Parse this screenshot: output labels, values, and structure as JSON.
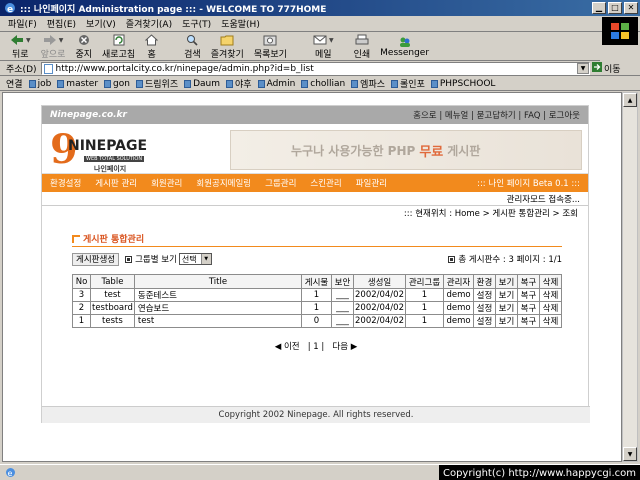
{
  "window": {
    "title": "::: 나인페이지 Administration page ::: - WELCOME TO 777HOME"
  },
  "menu": [
    "파일(F)",
    "편집(E)",
    "보기(V)",
    "즐겨찾기(A)",
    "도구(T)",
    "도움말(H)"
  ],
  "toolbar": {
    "back": "뒤로",
    "forward": "앞으로",
    "stop": "중지",
    "refresh": "새로고침",
    "home": "홈",
    "search": "검색",
    "favorites": "즐겨찾기",
    "history": "목록보기",
    "mail": "메일",
    "print": "인쇄",
    "messenger": "Messenger"
  },
  "address": {
    "label": "주소(D)",
    "url": "http://www.portalcity.co.kr/ninepage/admin.php?id=b_list",
    "go": "이동"
  },
  "links": {
    "label": "연결",
    "items": [
      "job",
      "master",
      "gon",
      "드림위즈",
      "Daum",
      "야후",
      "Admin",
      "chollian",
      "엠파스",
      "롤인포",
      "PHPSCHOOL"
    ]
  },
  "site": {
    "name": "Ninepage.co.kr",
    "toplinks": "홈으로 | 메뉴얼 | 묻고답하기 | FAQ | 로그아웃",
    "logo": {
      "nine": "9",
      "name": "NINEPAGE",
      "solution": "WEB TOTAL SOLUTION",
      "korean": "나인페이지"
    },
    "banner": {
      "pre": "누구나 사용가능한 PHP",
      "highlight": "무료",
      "post": "게시판"
    },
    "nav": [
      "환경설정",
      "게시판 관리",
      "회원관리",
      "회원공지메일링",
      "그룹관리",
      "스킨관리",
      "파일관리"
    ],
    "version": "::: 나인 페이지 Beta 0.1 :::",
    "admin_status": "관리자모드 접속중...",
    "breadcrumb": "::: 현재위치 : Home > 게시판 통합관리 > 조회"
  },
  "section": {
    "title": "게시판 통합관리",
    "create_button": "게시판생성",
    "group_view_label": "그룹별 보기",
    "select_value": "선택",
    "summary": "총 게시판수 : 3  페이지 : 1/1"
  },
  "table": {
    "headers": [
      "No",
      "Table",
      "Title",
      "게시물",
      "보안",
      "생성일",
      "관리그룹",
      "관리자",
      "환경",
      "보기",
      "복구",
      "삭제"
    ],
    "rows": [
      [
        "3",
        "test",
        "동준테스트",
        "1",
        "___",
        "2002/04/02",
        "1",
        "demo",
        "설정",
        "보기",
        "복구",
        "삭제"
      ],
      [
        "2",
        "testboard",
        "연습보드",
        "1",
        "___",
        "2002/04/02",
        "1",
        "demo",
        "설정",
        "보기",
        "복구",
        "삭제"
      ],
      [
        "1",
        "tests",
        "test",
        "0",
        "___",
        "2002/04/02",
        "1",
        "demo",
        "설정",
        "보기",
        "복구",
        "삭제"
      ]
    ]
  },
  "pager": {
    "prev": "◀ 이전",
    "pages": "| 1 |",
    "next": "다음 ▶"
  },
  "footer": "Copyright 2002 Ninepage. All rights reserved.",
  "watermark": "Copyright(c) http://www.happycgi.com"
}
